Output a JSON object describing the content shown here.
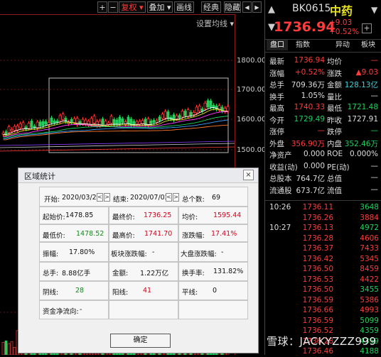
{
  "toolbar": {
    "plus": "+",
    "minus": "−",
    "fuquan": "复权",
    "diejia": "叠加",
    "huaxian": "画线",
    "jingdian": "经典",
    "yincang": "隐藏",
    "arrow_left": "◀",
    "arrow_right": "▶"
  },
  "chart": {
    "ma_setting": "设置均线",
    "price_labels": [
      "1800.00",
      "1700.00",
      "1600.00",
      "1500.00"
    ]
  },
  "dialog": {
    "title": "区域统计",
    "close": "×",
    "start_label": "开始:",
    "start_value": "2020/03/20",
    "end_label": "结束:",
    "end_value": "2020/07/02",
    "count_label": "总个数:",
    "count_value": "69",
    "open_label": "起始价:",
    "open_value": "1478.85",
    "close_label": "最终价:",
    "close_value": "1736.25",
    "avg_label": "均价:",
    "avg_value": "1595.44",
    "low_label": "最低价:",
    "low_value": "1478.52",
    "high_label": "最高价:",
    "high_value": "1741.70",
    "change_label": "涨跌幅:",
    "change_value": "17.41%",
    "amp_label": "振幅:",
    "amp_value": "17.80%",
    "sector_label": "板块涨跌幅:",
    "sector_value": "-",
    "index_label": "大盘涨跌幅:",
    "index_value": "-",
    "vol_label": "总手:",
    "vol_value": "8.88亿手",
    "amount_label": "金额:",
    "amount_value": "1.22万亿",
    "turnover_label": "换手率:",
    "turnover_value": "131.82%",
    "yin_label": "阴线:",
    "yin_value": "28",
    "yang_label": "阳线:",
    "yang_value": "41",
    "ping_label": "平线:",
    "ping_value": "0",
    "fund_label": "资金净流向:",
    "fund_value": "-",
    "ok_button": "确定",
    "prev": "<",
    "next": ">"
  },
  "quote": {
    "code": "BK0615",
    "name": "中药",
    "price": "1736.94",
    "change": "+9.03",
    "change_pct": "+0.52%",
    "add_button": "+",
    "nav_up": "▲",
    "nav_down": "▼",
    "tabs": [
      "盘口",
      "指数",
      "异动",
      "板块"
    ],
    "rows": [
      {
        "l1": "最新",
        "v1": "1736.94",
        "l2": "均价",
        "v2": "—"
      },
      {
        "l1": "涨幅",
        "v1": "+0.52%",
        "l2": "涨跌",
        "v2": "▲9.03"
      },
      {
        "l1": "总手",
        "v1": "709.36万",
        "l2": "金额",
        "v2": "128.13亿"
      },
      {
        "l1": "换手",
        "v1": "1.05%",
        "l2": "量比",
        "v2": "—"
      },
      {
        "l1": "最高",
        "v1": "1740.33",
        "l2": "最低",
        "v2": "1721.48"
      },
      {
        "l1": "今开",
        "v1": "1729.49",
        "l2": "昨收",
        "v2": "1727.91"
      },
      {
        "l1": "涨停",
        "v1": "—",
        "l2": "跌停",
        "v2": "—"
      },
      {
        "l1": "外盘",
        "v1": "356.90万",
        "l2": "内盘",
        "v2": "352.46万"
      },
      {
        "l1": "净资产",
        "v1": "0.000",
        "l2": "ROE",
        "v2": "0.000%"
      },
      {
        "l1": "收益(动)",
        "v1": "0.000",
        "l2": "PE(动)",
        "v2": "—"
      },
      {
        "l1": "总股本",
        "v1": "764.7亿",
        "l2": "总值",
        "v2": "—"
      },
      {
        "l1": "流通股",
        "v1": "673.7亿",
        "l2": "流值",
        "v2": "—"
      }
    ],
    "ticks": [
      {
        "time": "10:26",
        "price": "1736.11",
        "vol": "3648"
      },
      {
        "time": "",
        "price": "1736.26",
        "vol": "3884"
      },
      {
        "time": "10:27",
        "price": "1736.13",
        "vol": "4972"
      },
      {
        "time": "",
        "price": "1736.28",
        "vol": "4606"
      },
      {
        "time": "",
        "price": "1736.37",
        "vol": "7433"
      },
      {
        "time": "",
        "price": "1736.42",
        "vol": "5345"
      },
      {
        "time": "",
        "price": "1736.50",
        "vol": "8459"
      },
      {
        "time": "",
        "price": "1736.53",
        "vol": "4422"
      },
      {
        "time": "",
        "price": "1736.50",
        "vol": "3455"
      },
      {
        "time": "",
        "price": "1736.59",
        "vol": "5386"
      },
      {
        "time": "",
        "price": "1736.66",
        "vol": "4993"
      },
      {
        "time": "",
        "price": "1736.59",
        "vol": "5099"
      },
      {
        "time": "",
        "price": "1736.52",
        "vol": "4359"
      },
      {
        "time": "",
        "price": "1736.28",
        "vol": "4359"
      },
      {
        "time": "",
        "price": "1736.46",
        "vol": "4188"
      }
    ]
  },
  "watermark": "雪球：JACKYZZZ999"
}
